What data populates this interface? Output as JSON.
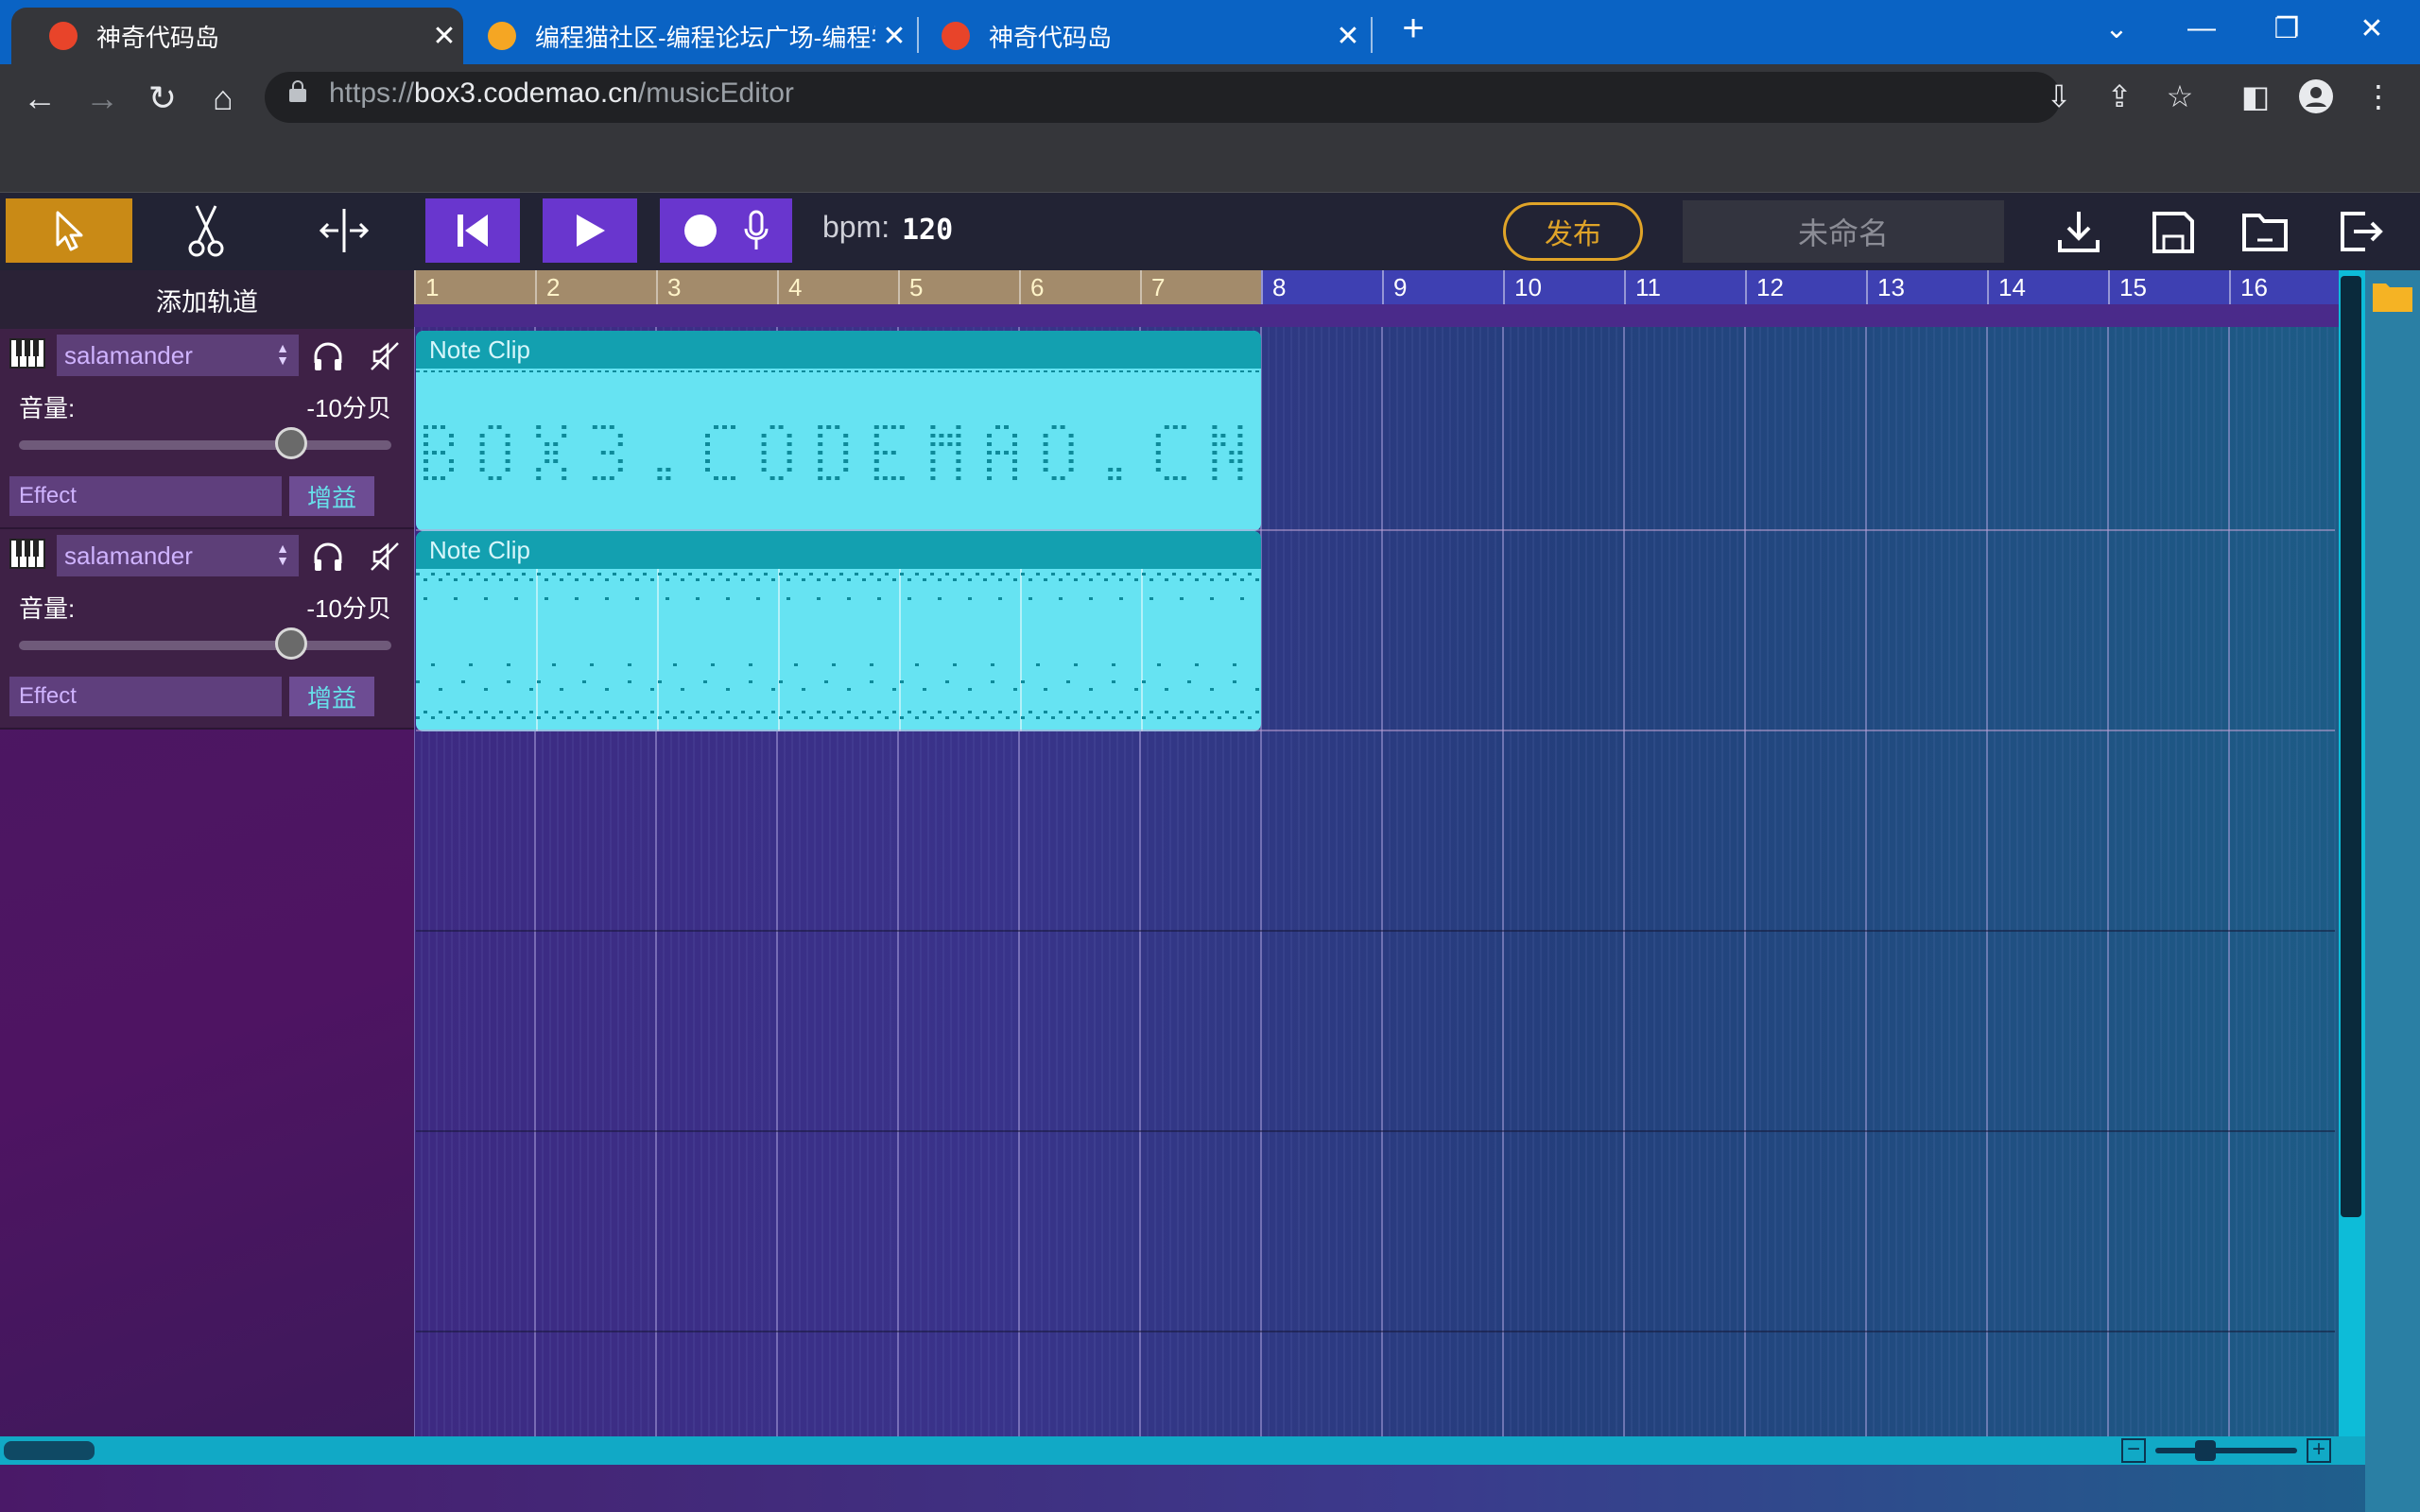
{
  "browser": {
    "tabs": [
      {
        "title": "神奇代码岛",
        "active": true
      },
      {
        "title": "编程猫社区-编程论坛广场-编程学",
        "active": false
      },
      {
        "title": "神奇代码岛",
        "active": false
      }
    ],
    "url_scheme": "https://",
    "url_host": "box3.codemao.cn",
    "url_path": "/musicEditor"
  },
  "editor": {
    "bpm_label": "bpm:",
    "bpm_value": "120",
    "publish_label": "发布",
    "project_name": "未命名",
    "add_track_label": "添加轨道",
    "loop_end_bar": 7,
    "ruler_bars": [
      "1",
      "2",
      "3",
      "4",
      "5",
      "6",
      "7",
      "8",
      "9",
      "10",
      "11",
      "12",
      "13",
      "14",
      "15",
      "16"
    ],
    "tracks": [
      {
        "instrument": "salamander",
        "volume_label": "音量:",
        "volume_value": "-10分贝",
        "volume_fraction": 0.73,
        "effect_label": "Effect",
        "gain_label": "增益",
        "clip_label": "Note Clip"
      },
      {
        "instrument": "salamander",
        "volume_label": "音量:",
        "volume_value": "-10分贝",
        "volume_fraction": 0.73,
        "effect_label": "Effect",
        "gain_label": "增益",
        "clip_label": "Note Clip"
      }
    ],
    "clip1_pixel_text": "BOX3.CODEMAO.CN",
    "zoom_level": 0.35
  },
  "colors": {
    "accent_tool": "#c98a16",
    "transport": "#6936ce",
    "publish": "#e0a428",
    "clip": "#66e3f2",
    "clip_header": "#13a0b0",
    "note": "#0e8a9a"
  },
  "icons": [
    "pointer-icon",
    "scissors-icon",
    "split-icon",
    "rewind-icon",
    "play-icon",
    "record-icon",
    "mic-icon",
    "download-icon",
    "save-icon",
    "open-folder-icon",
    "exit-icon",
    "piano-icon",
    "headphones-icon",
    "mute-icon",
    "folder-icon"
  ]
}
